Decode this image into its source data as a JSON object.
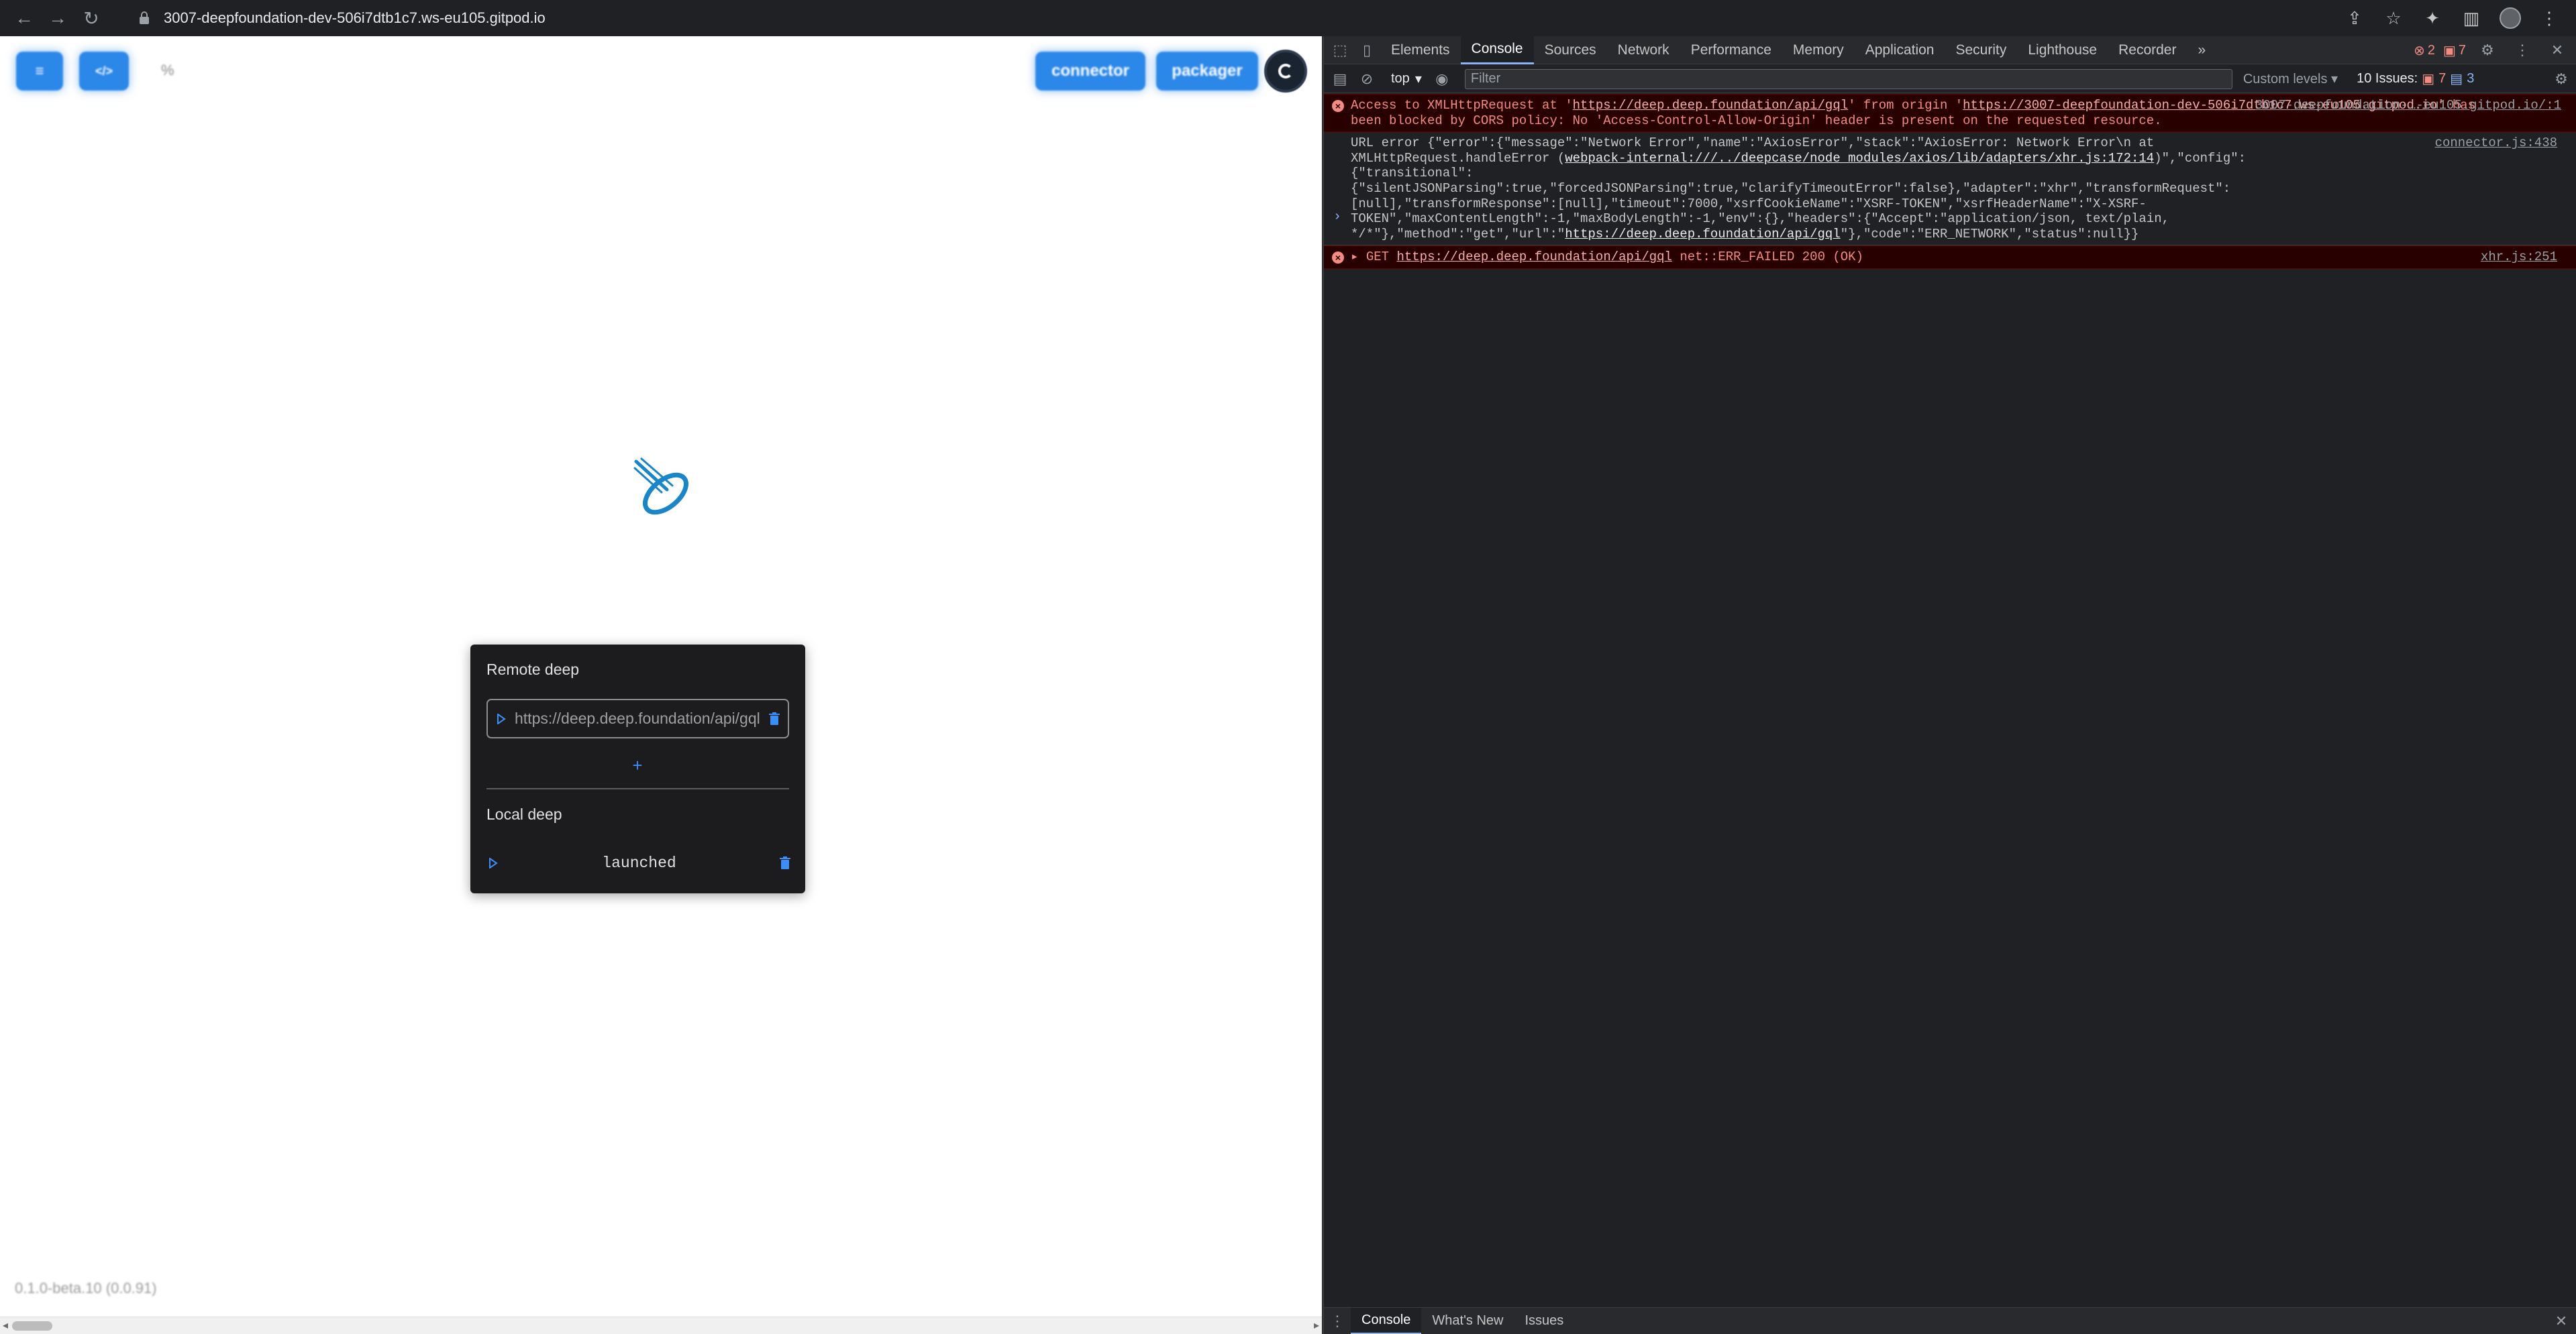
{
  "browser": {
    "url": "3007-deepfoundation-dev-506i7dtb1c7.ws-eu105.gitpod.io",
    "icons": [
      "back-icon",
      "forward-icon",
      "reload-icon",
      "lock-icon",
      "share-icon",
      "star-icon",
      "extensions-icon",
      "sidepanel-icon",
      "profile-avatar",
      "menu-icon"
    ]
  },
  "page": {
    "top_buttons": [
      {
        "label": "≡",
        "icon": "list-icon"
      },
      {
        "label": "</>",
        "icon": "code-icon"
      }
    ],
    "translate_glyph": "%",
    "connector_label": "connector",
    "packager_label": "packager",
    "card": {
      "remote_title": "Remote deep",
      "remote_input_value": "https://deep.deep.foundation/api/gql",
      "add_label": "+",
      "local_title": "Local deep",
      "local_status": "launched"
    },
    "version": "0.1.0-beta.10 (0.0.91)",
    "accent": "#2b87e8",
    "logo_color": "#1a86c7"
  },
  "devtools": {
    "tabs": [
      "Elements",
      "Console",
      "Sources",
      "Network",
      "Performance",
      "Memory",
      "Application",
      "Security",
      "Lighthouse",
      "Recorder"
    ],
    "active_tab": "Console",
    "more_tabs": "»",
    "errors_count": "2",
    "warnings_count": "7",
    "context": "top",
    "filter_placeholder": "Filter",
    "levels": "Custom levels",
    "issues_label": "10 Issues:",
    "issues_warn": "7",
    "issues_info": "3",
    "messages": {
      "cors": {
        "prefix": "Access to XMLHttpRequest at '",
        "link1": "https://deep.deep.foundation/api/gql",
        "mid": "' from origin '",
        "link2": "https://3007-deepfoundation-dev-506i7dtb1c7.ws-eu105.gitpod.io",
        "suffix": "' has been blocked by CORS policy: No 'Access-Control-Allow-Origin' header is present on the requested resource.",
        "source": "3007-deepfoundation-…-eu105.gitpod.io/:1"
      },
      "url_error": {
        "text1": "URL error {\"error\":{\"message\":\"Network Error\",\"name\":\"AxiosError\",\"stack\":\"AxiosError: Network Error\\n    at XMLHttpRequest.handleError (",
        "link": "webpack-internal:///../deepcase/node_modules/axios/lib/adapters/xhr.js:172:14",
        "text2": ")\",\"config\":{\"transitional\":{\"silentJSONParsing\":true,\"forcedJSONParsing\":true,\"clarifyTimeoutError\":false},\"adapter\":\"xhr\",\"transformRequest\":[null],\"transformResponse\":[null],\"timeout\":7000,\"xsrfCookieName\":\"XSRF-TOKEN\",\"xsrfHeaderName\":\"X-XSRF-TOKEN\",\"maxContentLength\":-1,\"maxBodyLength\":-1,\"env\":{},\"headers\":{\"Accept\":\"application/json, text/plain, */*\"},\"method\":\"get\",\"url\":\"",
        "link2": "https://deep.deep.foundation/api/gql",
        "text3": "\"},\"code\":\"ERR_NETWORK\",\"status\":null}}",
        "source": "connector.js:438"
      },
      "get_failed": {
        "method": "GET",
        "link": "https://deep.deep.foundation/api/gql",
        "status": "net::ERR_FAILED 200 (OK)",
        "source": "xhr.js:251"
      }
    },
    "prompt": "›",
    "drawer_tabs": [
      "Console",
      "What's New",
      "Issues"
    ],
    "drawer_active": "Console"
  }
}
